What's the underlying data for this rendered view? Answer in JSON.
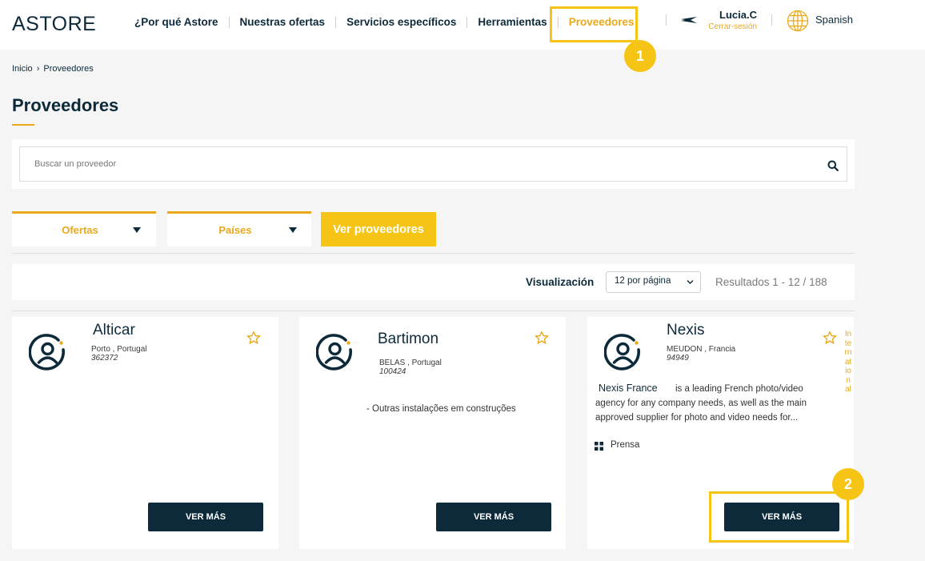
{
  "header": {
    "logo": "ASTORE",
    "nav": [
      {
        "label": "¿Por qué Astore"
      },
      {
        "label": "Nuestras ofertas"
      },
      {
        "label": "Servicios específicos"
      },
      {
        "label": "Herramientas"
      },
      {
        "label": "Proveedores"
      }
    ],
    "user": {
      "name": "Lucia.C",
      "logout": "Cerrar-sesión"
    },
    "language": "Spanish"
  },
  "annotations": {
    "step1": "1",
    "step2": "2"
  },
  "breadcrumb": {
    "home": "Inicio",
    "sep": "›",
    "current": "Proveedores"
  },
  "page_title": "Proveedores",
  "search": {
    "placeholder": "Buscar un proveedor"
  },
  "filters": {
    "offers": "Ofertas",
    "countries": "Países",
    "submit": "Ver proveedores"
  },
  "results": {
    "visualization_label": "Visualización",
    "per_page": "12 por página",
    "summary": "Resultados 1 - 12 / 188"
  },
  "cards": [
    {
      "name": "Alticar",
      "location": "Porto , Portugal",
      "id": "362372",
      "description": "",
      "button": "VER MÁS"
    },
    {
      "name": "Bartimon",
      "location": "BELAS , Portugal",
      "id": "100424",
      "description": "- Outras instalações em construções",
      "button": "VER MÁS"
    },
    {
      "name": "Nexis",
      "location": "MEUDON , Francia",
      "id": "94949",
      "description_name": "Nexis France",
      "description_line1": "is a leading French photo/video",
      "description_line2": "agency for any company needs, as well as the main",
      "description_line3": "approved supplier for photo and video needs for...",
      "tag": "Prensa",
      "side_label": "International",
      "button": "VER MÁS"
    }
  ],
  "colors": {
    "navy": "#0d2a3a",
    "gold": "#e9a91b",
    "highlight": "#f6c415"
  }
}
